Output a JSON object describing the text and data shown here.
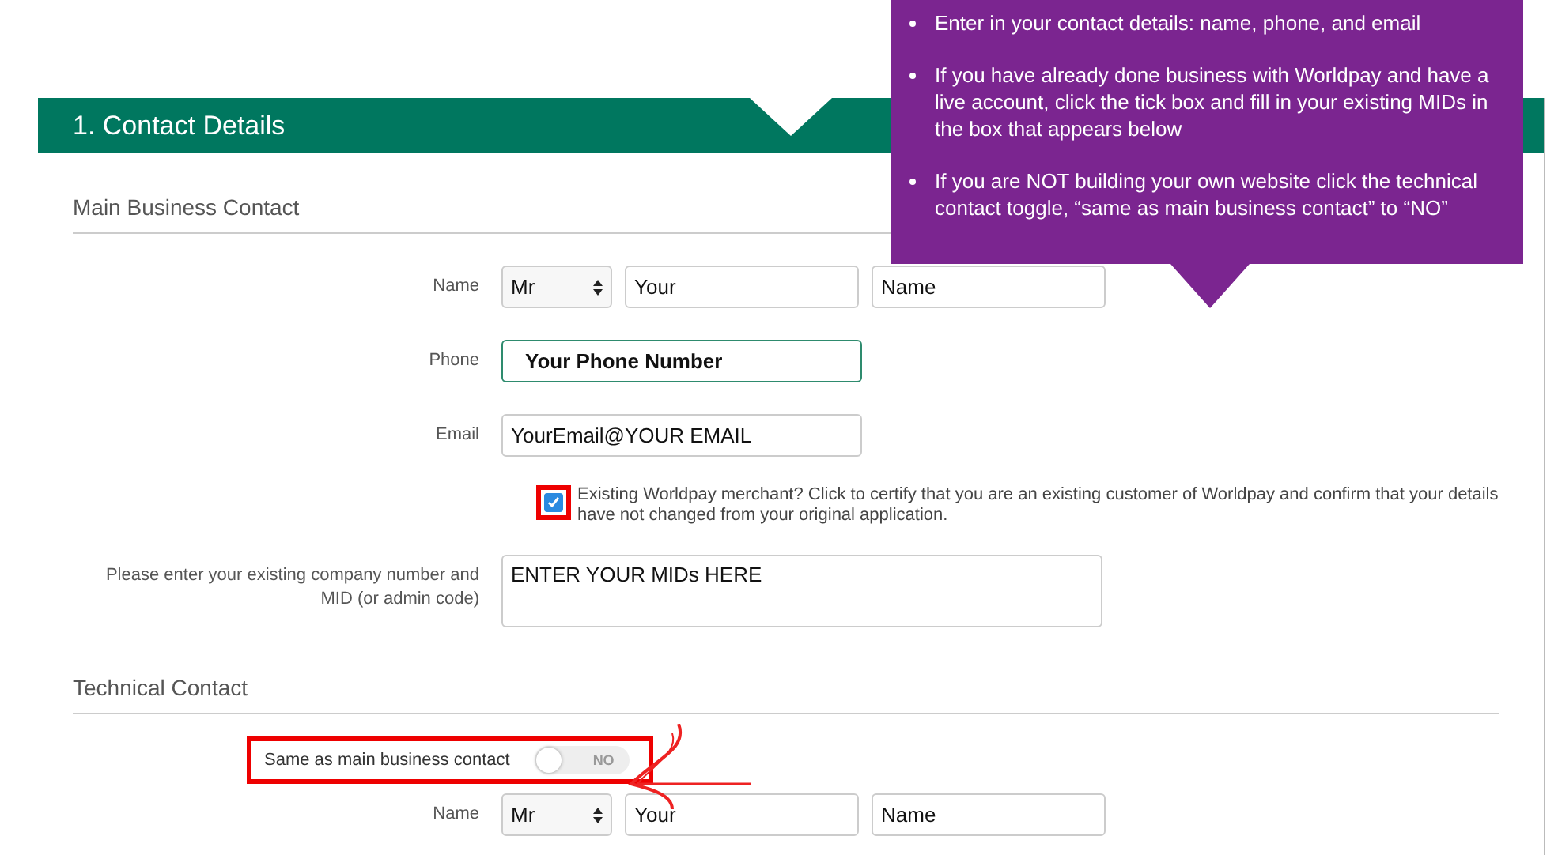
{
  "callout": {
    "bullets": [
      "Enter in your contact details: name, phone, and email",
      "If you have already done business with Worldpay and have a live account, click the tick box and fill in your existing MIDs in  the box that appears below",
      "If you are NOT building your own website click the technical contact toggle, “same as main business contact” to “NO”"
    ]
  },
  "header": {
    "title": "1. Contact Details"
  },
  "main_contact": {
    "heading": "Main Business Contact",
    "name": {
      "label": "Name",
      "title": "Mr",
      "first": "Your",
      "last": "Name"
    },
    "phone": {
      "label": "Phone",
      "value": "Your Phone Number"
    },
    "email": {
      "label": "Email",
      "value": "YourEmail@YOUR EMAIL"
    },
    "merchant_checkbox": {
      "checked": true,
      "label": "Existing Worldpay merchant? Click to certify that you are an existing customer of Worldpay and confirm that your details have not changed from your original application."
    },
    "mid": {
      "label": "Please enter your existing company number and MID (or admin code)",
      "value": "ENTER YOUR MIDs HERE"
    }
  },
  "technical_contact": {
    "heading": "Technical Contact",
    "same_as_main": {
      "label": "Same as main business contact",
      "on": false,
      "state_label": "NO"
    },
    "name": {
      "label": "Name",
      "title": "Mr",
      "first": "Your",
      "last": "Name"
    }
  }
}
